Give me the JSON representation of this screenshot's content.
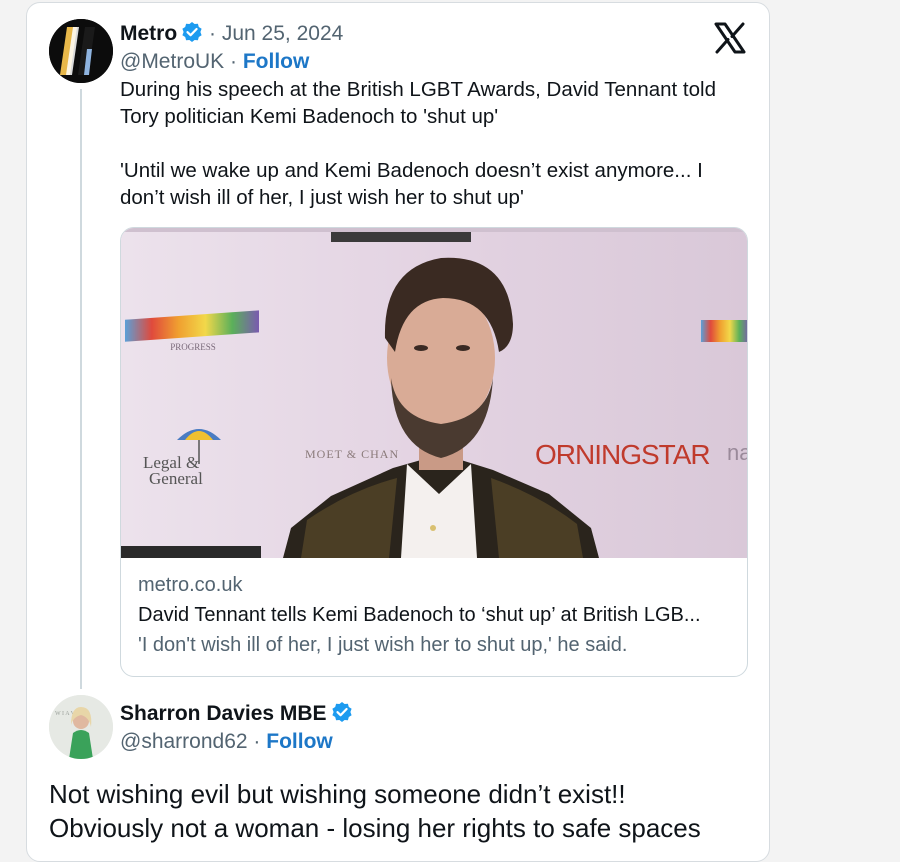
{
  "colors": {
    "verified_badge": "#1d9bf0",
    "follow_link": "#1d77c7",
    "secondary_text": "#536471"
  },
  "main_tweet": {
    "author_name": "Metro",
    "date": "Jun 25, 2024",
    "handle": "@MetroUK",
    "separator": "·",
    "follow_label": "Follow",
    "text_line1": "During his speech at the British LGBT Awards, David Tennant told",
    "text_line2": "Tory politician Kemi Badenoch to 'shut up'",
    "quote_line1": "'Until we wake up and Kemi Badenoch doesn’t exist anymore... I",
    "quote_line2": "don’t wish ill of her, I just wish her to shut up'",
    "avatar_icon": "metro-logo-icon",
    "platform_icon": "x-logo-icon"
  },
  "link_card": {
    "domain": "metro.co.uk",
    "title": "David Tennant tells Kemi Badenoch to ‘shut up’ at British LGB...",
    "description": "'I don't wish ill of her, I just wish her to shut up,' he said.",
    "photo_banner": {
      "brand1_line1": "Legal &",
      "brand1_line2": "General",
      "brand2": "MOET & CHAN",
      "brand3": "ORNINGSTAR",
      "brand4": "na",
      "pride_text": "PROGRESS"
    }
  },
  "reply_tweet": {
    "author_name": "Sharron Davies MBE",
    "handle": "@sharrond62",
    "separator": "·",
    "follow_label": "Follow",
    "text_line1": "Not wishing evil but wishing someone didn’t exist!!",
    "text_line2": "Obviously not a woman - losing her rights to safe spaces"
  }
}
